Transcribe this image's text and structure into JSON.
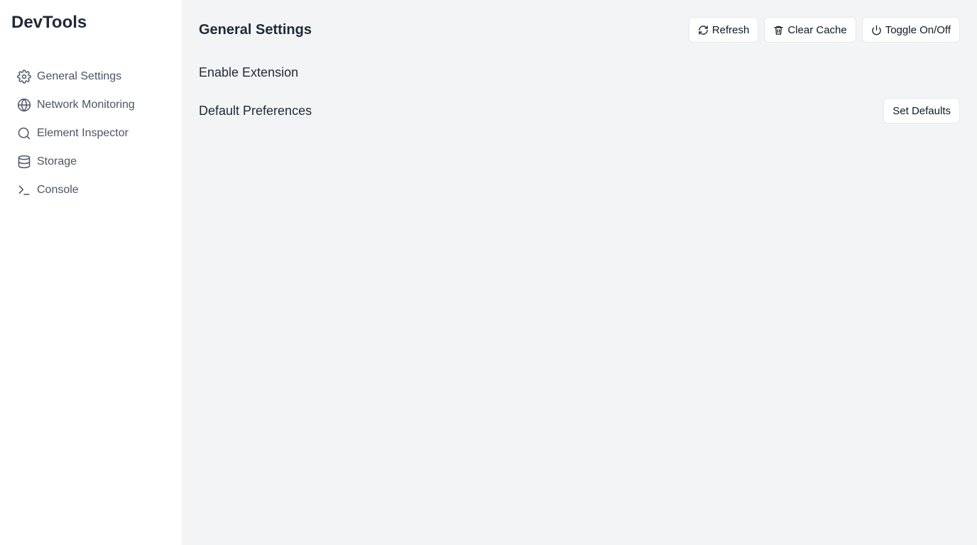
{
  "app": {
    "title": "DevTools"
  },
  "sidebar": {
    "items": [
      {
        "label": "General Settings",
        "icon": "gear-icon"
      },
      {
        "label": "Network Monitoring",
        "icon": "globe-icon"
      },
      {
        "label": "Element Inspector",
        "icon": "search-icon"
      },
      {
        "label": "Storage",
        "icon": "database-icon"
      },
      {
        "label": "Console",
        "icon": "terminal-icon"
      }
    ]
  },
  "main": {
    "title": "General Settings",
    "toolbar": {
      "refresh_label": "Refresh",
      "clear_cache_label": "Clear Cache",
      "toggle_label": "Toggle On/Off"
    },
    "sections": {
      "enable_extension": "Enable Extension",
      "default_preferences": "Default Preferences",
      "set_defaults_label": "Set Defaults"
    }
  },
  "colors": {
    "sidebar_bg": "#ffffff",
    "main_bg": "#f3f4f6",
    "text_primary": "#1f2937",
    "text_secondary": "#4b5563",
    "border": "#e5e7eb"
  }
}
